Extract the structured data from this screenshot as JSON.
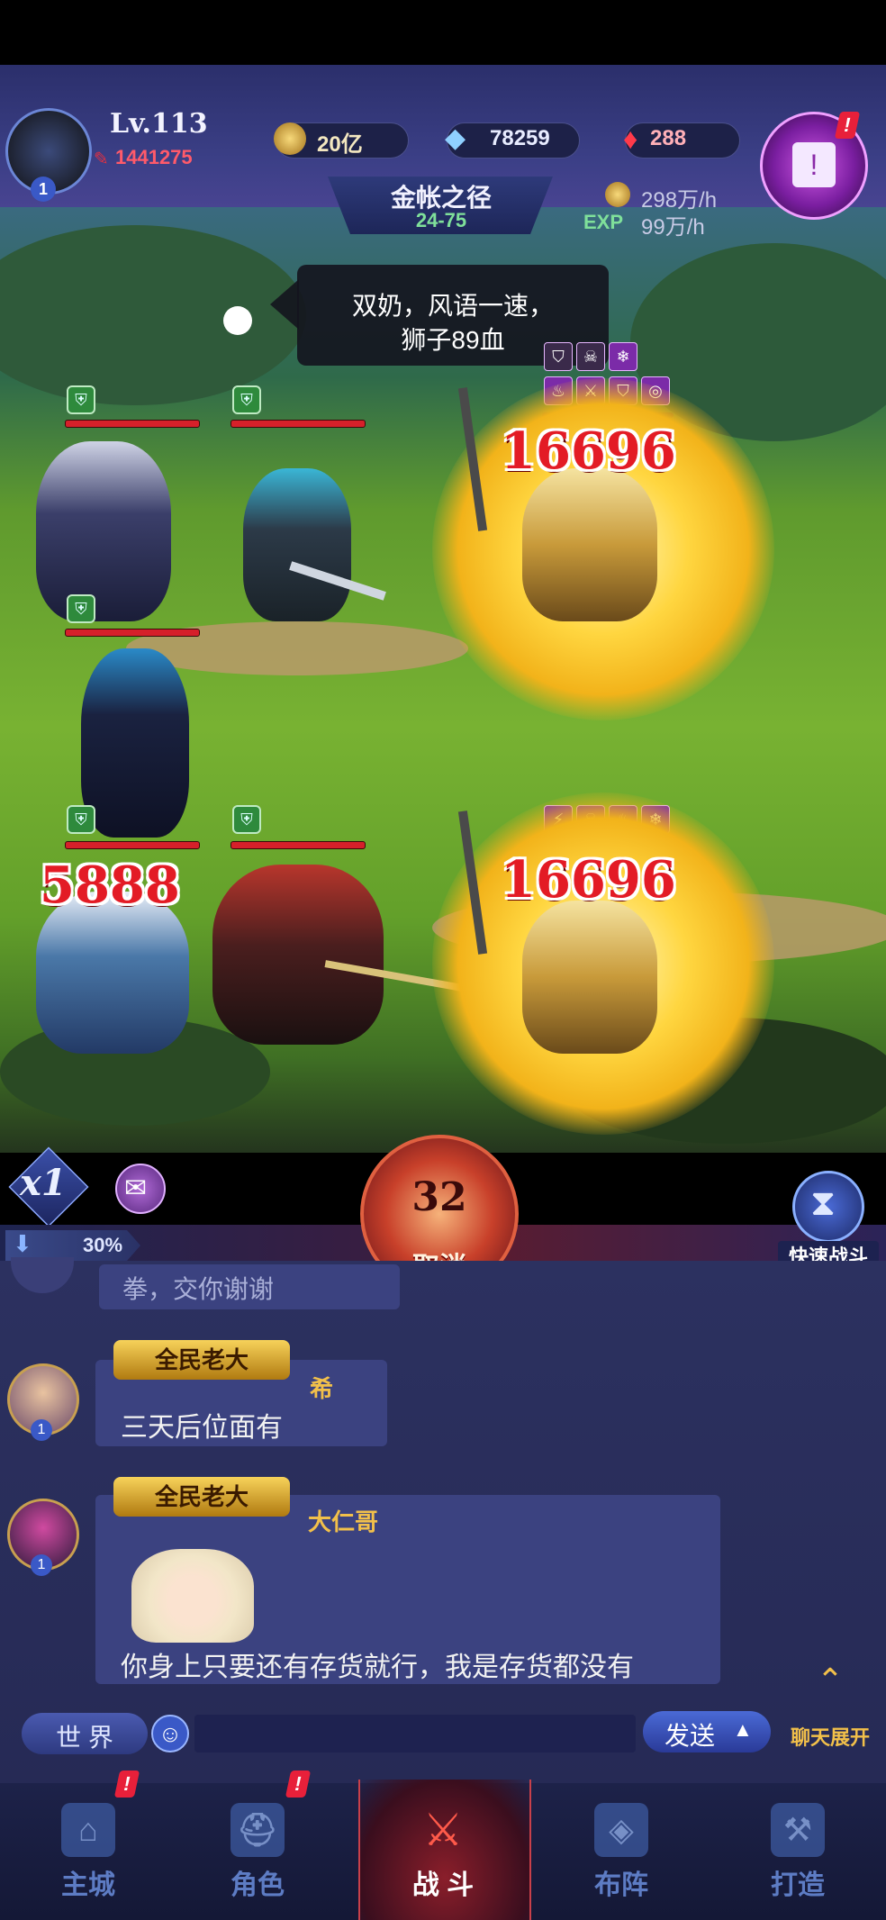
{
  "player": {
    "level": "Lv.113",
    "power": "1441275",
    "avatar_rank": "1"
  },
  "currencies": [
    {
      "icon": "gold-coin-icon",
      "value": "20亿"
    },
    {
      "icon": "diamond-icon",
      "value": "78259"
    },
    {
      "icon": "red-gem-icon",
      "value": "288"
    }
  ],
  "stage": {
    "name": "金帐之径",
    "level": "24-75"
  },
  "income": {
    "gold_rate": "298万/h",
    "exp_label": "EXP",
    "exp_rate": "99万/h"
  },
  "tooltip": {
    "line1": "双奶，风语一速，",
    "line2": "狮子89血"
  },
  "battle": {
    "damage_ally": "5888",
    "damage_enemy_top": "16696",
    "damage_enemy_bottom": "16696",
    "speed": "x1",
    "turn_counter": "32",
    "cancel_label": "取消",
    "quick_battle_label": "快速战斗",
    "buff_percent": "30%"
  },
  "chat": {
    "partial_message": "拳，交你谢谢",
    "messages": [
      {
        "badge": "全民老大",
        "name": "希",
        "text": "三天后位面有",
        "rank": "1"
      },
      {
        "badge": "全民老大",
        "name": "大仁哥",
        "text": "你身上只要还有存货就行，我是存货都没有",
        "rank": "1"
      }
    ],
    "channel": "世 界",
    "send_label": "发送",
    "expand_label": "聊天展开"
  },
  "nav": [
    {
      "label": "主城",
      "icon": "castle-icon",
      "alert": "!"
    },
    {
      "label": "角色",
      "icon": "helmet-icon",
      "alert": "!"
    },
    {
      "label": "战 斗",
      "icon": "crossed-swords-icon"
    },
    {
      "label": "布阵",
      "icon": "formation-icon"
    },
    {
      "label": "打造",
      "icon": "anvil-icon"
    }
  ],
  "colors": {
    "damage": "#e31b25",
    "accent_gold": "#f2c04a",
    "active_nav": "#ffffff"
  }
}
